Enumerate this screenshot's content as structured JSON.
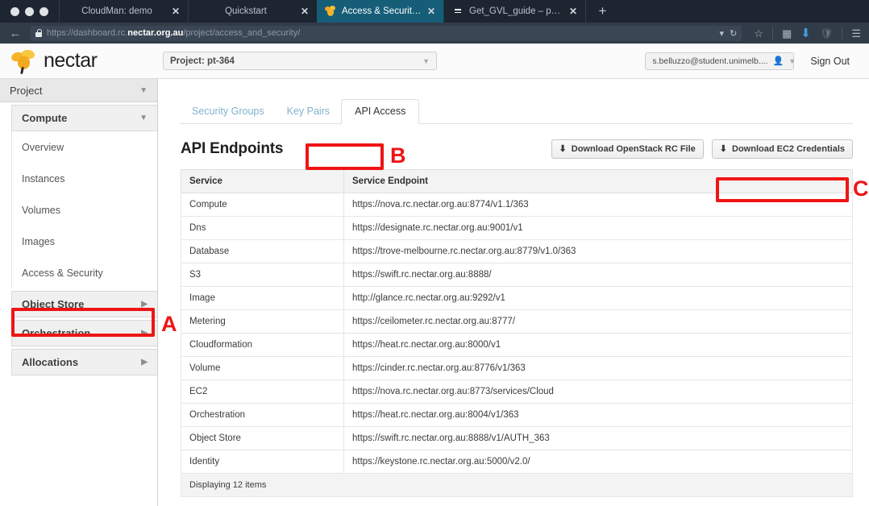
{
  "browser": {
    "traffic_lights": [
      "close",
      "minimize",
      "maximize"
    ],
    "tabs": [
      {
        "title": "CloudMan: demo",
        "close": "✕",
        "active": false,
        "favicon": "none"
      },
      {
        "title": "Quickstart",
        "close": "✕",
        "active": false,
        "favicon": "none"
      },
      {
        "title": "Access & Security – NeCT...",
        "close": "✕",
        "active": true,
        "favicon": "nectar-icon"
      },
      {
        "title": "Get_GVL_guide – personal",
        "close": "✕",
        "active": false,
        "favicon": "document-icon"
      }
    ],
    "new_tab_label": "+",
    "back_label": "←",
    "url": {
      "scheme": "https://",
      "subdomain": "dashboard.rc.",
      "domain": "nectar.org.au",
      "path": "/project/access_and_security/",
      "full": "https://dashboard.rc.nectar.org.au/project/access_and_security/"
    },
    "url_right_icons": [
      "chevron-down-icon",
      "reload-icon"
    ],
    "chrome_icons": [
      "star-icon",
      "reading-list-icon",
      "download-icon",
      "shield-icon",
      "menu-icon"
    ]
  },
  "topbar": {
    "logo_text": "nectar",
    "project_select": "Project: pt-364",
    "user_account": "s.belluzzo@student.unimelb....",
    "sign_out": "Sign Out"
  },
  "sidebar": {
    "project_label": "Project",
    "compute_label": "Compute",
    "items": [
      {
        "label": "Overview"
      },
      {
        "label": "Instances"
      },
      {
        "label": "Volumes"
      },
      {
        "label": "Images"
      },
      {
        "label": "Access & Security"
      }
    ],
    "groups": [
      {
        "label": "Object Store"
      },
      {
        "label": "Orchestration"
      },
      {
        "label": "Allocations"
      }
    ]
  },
  "content": {
    "tabs": [
      {
        "label": "Security Groups",
        "active": false
      },
      {
        "label": "Key Pairs",
        "active": false
      },
      {
        "label": "API Access",
        "active": true
      }
    ],
    "section_title": "API Endpoints",
    "buttons": [
      {
        "label": "Download OpenStack RC File",
        "icon": "download-icon"
      },
      {
        "label": "Download EC2 Credentials",
        "icon": "download-icon"
      }
    ],
    "table": {
      "headers": [
        "Service",
        "Service Endpoint"
      ],
      "rows": [
        [
          "Compute",
          "https://nova.rc.nectar.org.au:8774/v1.1/363"
        ],
        [
          "Dns",
          "https://designate.rc.nectar.org.au:9001/v1"
        ],
        [
          "Database",
          "https://trove-melbourne.rc.nectar.org.au:8779/v1.0/363"
        ],
        [
          "S3",
          "https://swift.rc.nectar.org.au:8888/"
        ],
        [
          "Image",
          "http://glance.rc.nectar.org.au:9292/v1"
        ],
        [
          "Metering",
          "https://ceilometer.rc.nectar.org.au:8777/"
        ],
        [
          "Cloudformation",
          "https://heat.rc.nectar.org.au:8000/v1"
        ],
        [
          "Volume",
          "https://cinder.rc.nectar.org.au:8776/v1/363"
        ],
        [
          "EC2",
          "https://nova.rc.nectar.org.au:8773/services/Cloud"
        ],
        [
          "Orchestration",
          "https://heat.rc.nectar.org.au:8004/v1/363"
        ],
        [
          "Object Store",
          "https://swift.rc.nectar.org.au:8888/v1/AUTH_363"
        ],
        [
          "Identity",
          "https://keystone.rc.nectar.org.au:5000/v2.0/"
        ]
      ],
      "footer": "Displaying 12 items"
    }
  },
  "annotations": {
    "color": "#f01414",
    "markers": [
      {
        "letter": "A",
        "target": "Access & Security sidebar item"
      },
      {
        "letter": "B",
        "target": "API Access tab"
      },
      {
        "letter": "C",
        "target": "Download EC2 Credentials button"
      }
    ]
  }
}
